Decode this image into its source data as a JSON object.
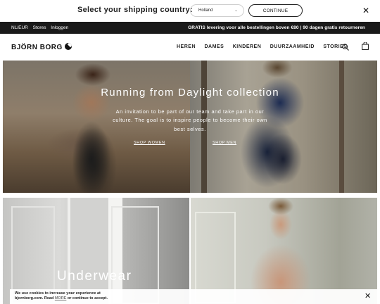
{
  "shipping": {
    "title": "Select your shipping country:",
    "country": "Holland",
    "continue_label": "CONTINUE"
  },
  "topbar": {
    "region": "NL/EUR",
    "stores": "Stores",
    "login": "Inloggen",
    "promo": "GRATIS levering voor alle bestellingen boven €80 | 90 dagen gratis retourneren"
  },
  "header": {
    "logo": "BJÖRN BORG",
    "nav": [
      "HEREN",
      "DAMES",
      "KINDEREN",
      "DUURZAAMHEID",
      "STORIES"
    ]
  },
  "hero": {
    "title": "Running from Daylight collection",
    "text": "An invitation to be part of our team and take part in our culture. The goal is to inspire people to become their own best selves.",
    "shop_women": "SHOP WOMEN",
    "shop_men": "SHOP MEN"
  },
  "tiles": {
    "left_title": "Underwear"
  },
  "cookie": {
    "line1": "We use cookies to increase your experience at",
    "line2_prefix": "bjornborg.com. Read",
    "more": "MORE",
    "line2_suffix": "or continue to accept."
  },
  "colors": {
    "topbar_bg": "#1a1a1a",
    "accent": "#111111"
  },
  "icons": [
    "close-icon",
    "chevron-down-icon",
    "search-icon",
    "bag-icon",
    "logo-mark"
  ]
}
